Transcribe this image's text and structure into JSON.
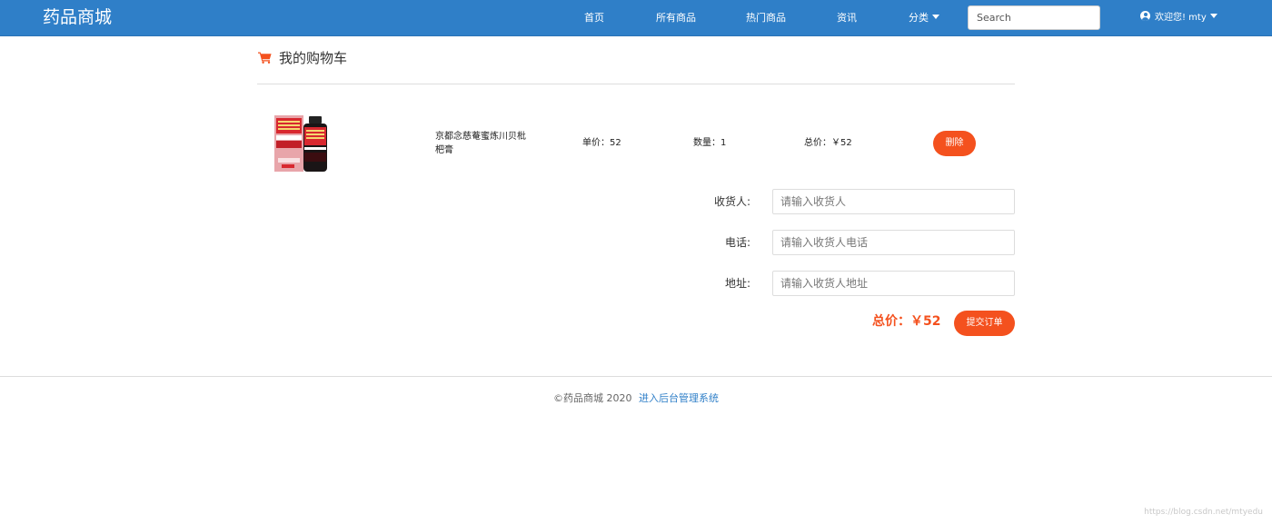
{
  "navbar": {
    "brand": "药品商城",
    "links": [
      "首页",
      "所有商品",
      "热门商品",
      "资讯"
    ],
    "category_label": "分类",
    "search_placeholder": "Search",
    "user_label": "欢迎您! mty"
  },
  "page": {
    "title": "我的购物车"
  },
  "cart": {
    "items": [
      {
        "name": "京都念慈菴蜜炼川贝枇杷膏",
        "unit_price": "单价：52",
        "quantity": "数量：1",
        "subtotal": "总价：￥52",
        "delete_label": "删除"
      }
    ]
  },
  "form": {
    "receiver_label": "收货人:",
    "receiver_placeholder": "请输入收货人",
    "phone_label": "电话:",
    "phone_placeholder": "请输入收货人电话",
    "address_label": "地址:",
    "address_placeholder": "请输入收货人地址"
  },
  "order": {
    "total": "总价：￥52",
    "submit_label": "提交订单"
  },
  "footer": {
    "copyright": "©药品商城 2020",
    "admin_link": "进入后台管理系统"
  },
  "watermark": "https://blog.csdn.net/mtyedu",
  "colors": {
    "navbar": "#2f7fc8",
    "accent": "#f4511e"
  }
}
